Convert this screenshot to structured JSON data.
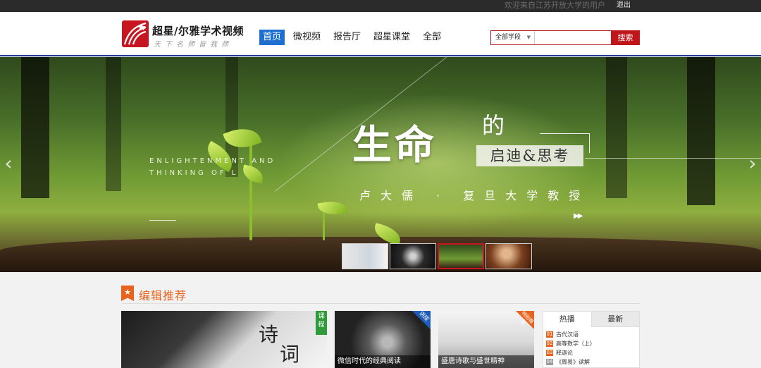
{
  "topbar": {
    "welcome": "欢迎来自江苏开放大学的用户",
    "logout": "退出"
  },
  "header": {
    "logo_title": "超星/尔雅学术视频",
    "logo_sub": "天下名师皆我师",
    "nav": [
      {
        "label": "首页",
        "active": true
      },
      {
        "label": "微视频",
        "active": false
      },
      {
        "label": "报告厅",
        "active": false
      },
      {
        "label": "超星课堂",
        "active": false
      },
      {
        "label": "全部",
        "active": false
      }
    ],
    "search": {
      "scope": "全部学段",
      "placeholder": "",
      "button": "搜索"
    }
  },
  "banner": {
    "en_line1": "ENLIGHTENMENT AND",
    "en_line2": "THINKING OF L",
    "title_main": "生命",
    "title_de": "的",
    "title_sub": "启迪&思考",
    "lecturer": "卢大儒 · 复旦大学教授",
    "play": "▶▶",
    "arrow_left": "‹",
    "arrow_right": "›",
    "thumb_count": 4,
    "active_thumb": 3
  },
  "section": {
    "icon": "★",
    "title": "编辑推荐"
  },
  "cards": [
    {
      "badge": "课程",
      "caption": "",
      "brush": [
        "诗",
        "词"
      ]
    },
    {
      "badge": "讲座",
      "caption": "微信时代的经典阅读"
    },
    {
      "badge": "特别推荐",
      "caption": "盛唐诗歌与盛世精神"
    }
  ],
  "rank": {
    "tabs": [
      "热播",
      "最新"
    ],
    "items": [
      {
        "num": "01",
        "title": "古代汉语"
      },
      {
        "num": "02",
        "title": "高等数学（上）"
      },
      {
        "num": "03",
        "title": "释迦论"
      },
      {
        "num": "04",
        "title": "《周易》读解"
      }
    ]
  },
  "colors": {
    "brand_red": "#c7161f",
    "nav_active": "#1f6fd1",
    "accent_orange": "#e8641e",
    "header_rule": "#1f3e8c"
  }
}
